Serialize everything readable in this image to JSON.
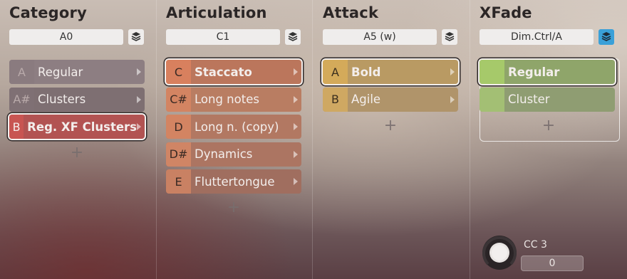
{
  "columns": [
    {
      "title": "Category",
      "slot": "A0",
      "items": [
        {
          "key": "A",
          "label": "Regular",
          "key_color": "#8a7b7f",
          "body_color": "#8d7e82",
          "key_text": "#b9aaaa"
        },
        {
          "key": "A#",
          "label": "Clusters",
          "key_color": "#7f7074",
          "body_color": "#7e6f72",
          "key_text": "#b9aaaa"
        },
        {
          "key": "B",
          "label": "Reg. XF Clusters",
          "key_color": "#c85552",
          "body_color": "#b25352",
          "key_text": "#f5ecea",
          "selected": true
        }
      ],
      "add_label": "+"
    },
    {
      "title": "Articulation",
      "slot": "C1",
      "items": [
        {
          "key": "C",
          "label": "Staccato",
          "key_color": "#d8805e",
          "body_color": "#bb765c",
          "key_text": "#3a2a24",
          "selected": true
        },
        {
          "key": "C#",
          "label": "Long notes",
          "key_color": "#d38462",
          "body_color": "#b97d62",
          "key_text": "#3a2a24"
        },
        {
          "key": "D",
          "label": "Long n. (copy)",
          "key_color": "#d38462",
          "body_color": "#b27862",
          "key_text": "#3a2a24"
        },
        {
          "key": "D#",
          "label": "Dynamics",
          "key_color": "#d08565",
          "body_color": "#ac7562",
          "key_text": "#3a2a24"
        },
        {
          "key": "E",
          "label": "Fluttertongue",
          "key_color": "#c98163",
          "body_color": "#a06e5f",
          "key_text": "#3a2a24"
        }
      ],
      "add_label": "+"
    },
    {
      "title": "Attack",
      "slot": "A5 (w)",
      "items": [
        {
          "key": "A",
          "label": "Bold",
          "key_color": "#d4aa5a",
          "body_color": "#b99a63",
          "key_text": "#3a2e1e",
          "selected": true
        },
        {
          "key": "B",
          "label": "Agile",
          "key_color": "#cfa862",
          "body_color": "#b0946a",
          "key_text": "#3a2e1e"
        }
      ],
      "add_label": "+"
    },
    {
      "title": "XFade",
      "slot": "Dim.Ctrl/A",
      "stack_active": true,
      "items": [
        {
          "key": "",
          "label": "Regular",
          "key_color": "#a6c96a",
          "body_color": "#8fa56a",
          "key_text": "#2a3420",
          "selected": true
        },
        {
          "key": "",
          "label": "Cluster",
          "key_color": "#a3bf74",
          "body_color": "#8f9d72",
          "key_text": "#2a3420"
        }
      ],
      "add_label": "+"
    }
  ],
  "cc": {
    "label": "CC 3",
    "value": "0"
  },
  "icons": {
    "stack": "layers-icon",
    "arrow": "chevron-right-icon",
    "knob": "knob-icon"
  }
}
